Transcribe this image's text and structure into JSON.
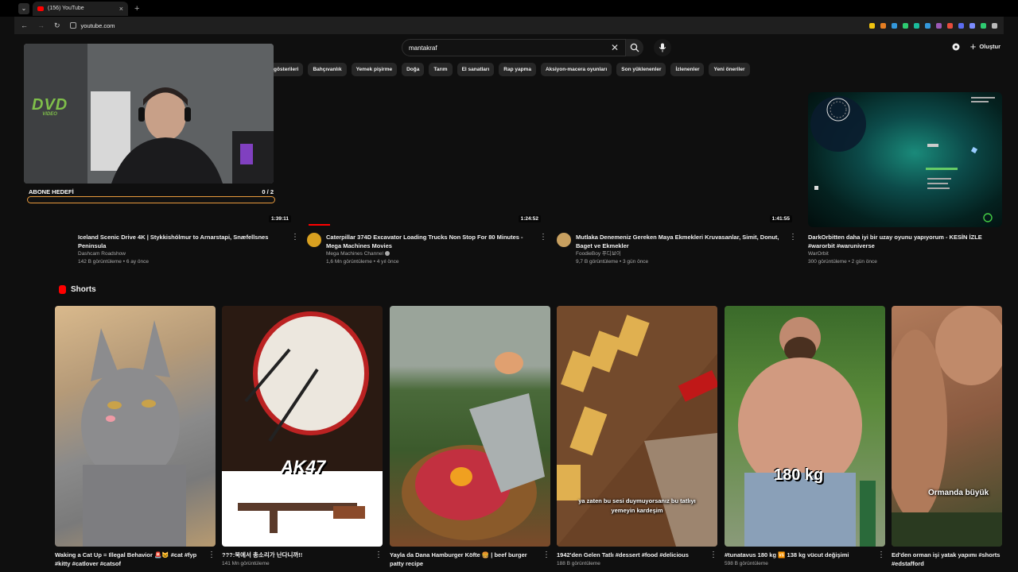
{
  "browser": {
    "tab_title": "(156) YouTube",
    "url": "youtube.com",
    "extension_icons": [
      "#f1c40f",
      "#e67e22",
      "#3498db",
      "#2ecc71",
      "#1abc9c",
      "#3498db",
      "#9b59b6",
      "#e74c3c",
      "#5b6cf0",
      "#7c8cff",
      "#2ecc71",
      "#bbbbbb"
    ]
  },
  "header": {
    "search_value": "mantakraf",
    "create_label": "Oluştur"
  },
  "chips": [
    "gösterileri",
    "Bahçıvanlık",
    "Yemek pişirme",
    "Doğa",
    "Tarım",
    "El sanatları",
    "Rap yapma",
    "Aksiyon-macera oyunları",
    "Son yüklenenler",
    "İzlenenler",
    "Yeni öneriler"
  ],
  "videos": [
    {
      "duration": "1:39:11",
      "title": "Iceland Scenic Drive 4K | Stykkishólmur to Arnarstapi, Snæfellsnes Peninsula",
      "channel": "Dashcam Roadshow",
      "stats": "142 B görüntüleme • 6 ay önce",
      "avatar": "#3a4a5a",
      "progress": 0
    },
    {
      "duration": "1:24:52",
      "title": "Caterpillar 374D Excavator Loading Trucks Non Stop For 80 Minutes - Mega Machines Movies",
      "channel": "Mega Machines Channel",
      "stats": "1,6 Mn görüntüleme • 4 yıl önce",
      "avatar": "#d8a020",
      "progress": 0.09
    },
    {
      "duration": "1:41:55",
      "title": "Mutlaka Denemeniz Gereken Maya Ekmekleri Kruvasanlar, Simit, Donut, Baget ve Ekmekler",
      "channel": "FoodieBoy 푸디보이",
      "stats": "9,7 B görüntüleme • 3 gün önce",
      "avatar": "#c8a060",
      "progress": 0
    },
    {
      "duration": "",
      "title": "DarkOrbitten daha iyi bir uzay oyunu yapıyorum - KESİN İZLE #warorbit  #waruniverse",
      "channel": "WarOrbit",
      "stats": "300 görüntüleme • 2 gün önce",
      "avatar": "#1c2c3c",
      "progress": 0
    }
  ],
  "shorts": {
    "heading": "Shorts",
    "items": [
      {
        "title": "Waking a Cat Up = Illegal Behavior 🚨😺 #cat #fyp #kitty #catlover #catsof",
        "views": "",
        "overlay": ""
      },
      {
        "title": "???:북에서 총소리가 난다니까!!",
        "views": "141 Mn görüntüleme",
        "overlay": "AK47"
      },
      {
        "title": "Yayla da Dana Hamburger Köfte 🍔 | beef burger patty recipe",
        "views": "",
        "overlay": ""
      },
      {
        "title": "1942'den Gelen Tatlı #dessert #food #delicious",
        "views": "188 B görüntüleme",
        "overlay": "ya zaten bu sesi duymuyorsanız bu tatlıyı yemeyin kardeşim"
      },
      {
        "title": "#tunatavus 180 kg 🆚 138 kg vücut değişimi",
        "views": "598 B görüntüleme",
        "overlay": "180 kg"
      },
      {
        "title": "Ed'den orman işi yatak yapımı #shorts #edstafford",
        "views": "",
        "overlay": "Ormanda büyük"
      }
    ]
  },
  "webcam": {
    "logo": "DVD",
    "logo_sub": "VIDEO"
  },
  "goal": {
    "label": "ABONE HEDEFİ",
    "count": "0 / 2",
    "progress": 0
  },
  "colors": {
    "accent": "#ff0000",
    "goal_border": "#e89a3c"
  }
}
